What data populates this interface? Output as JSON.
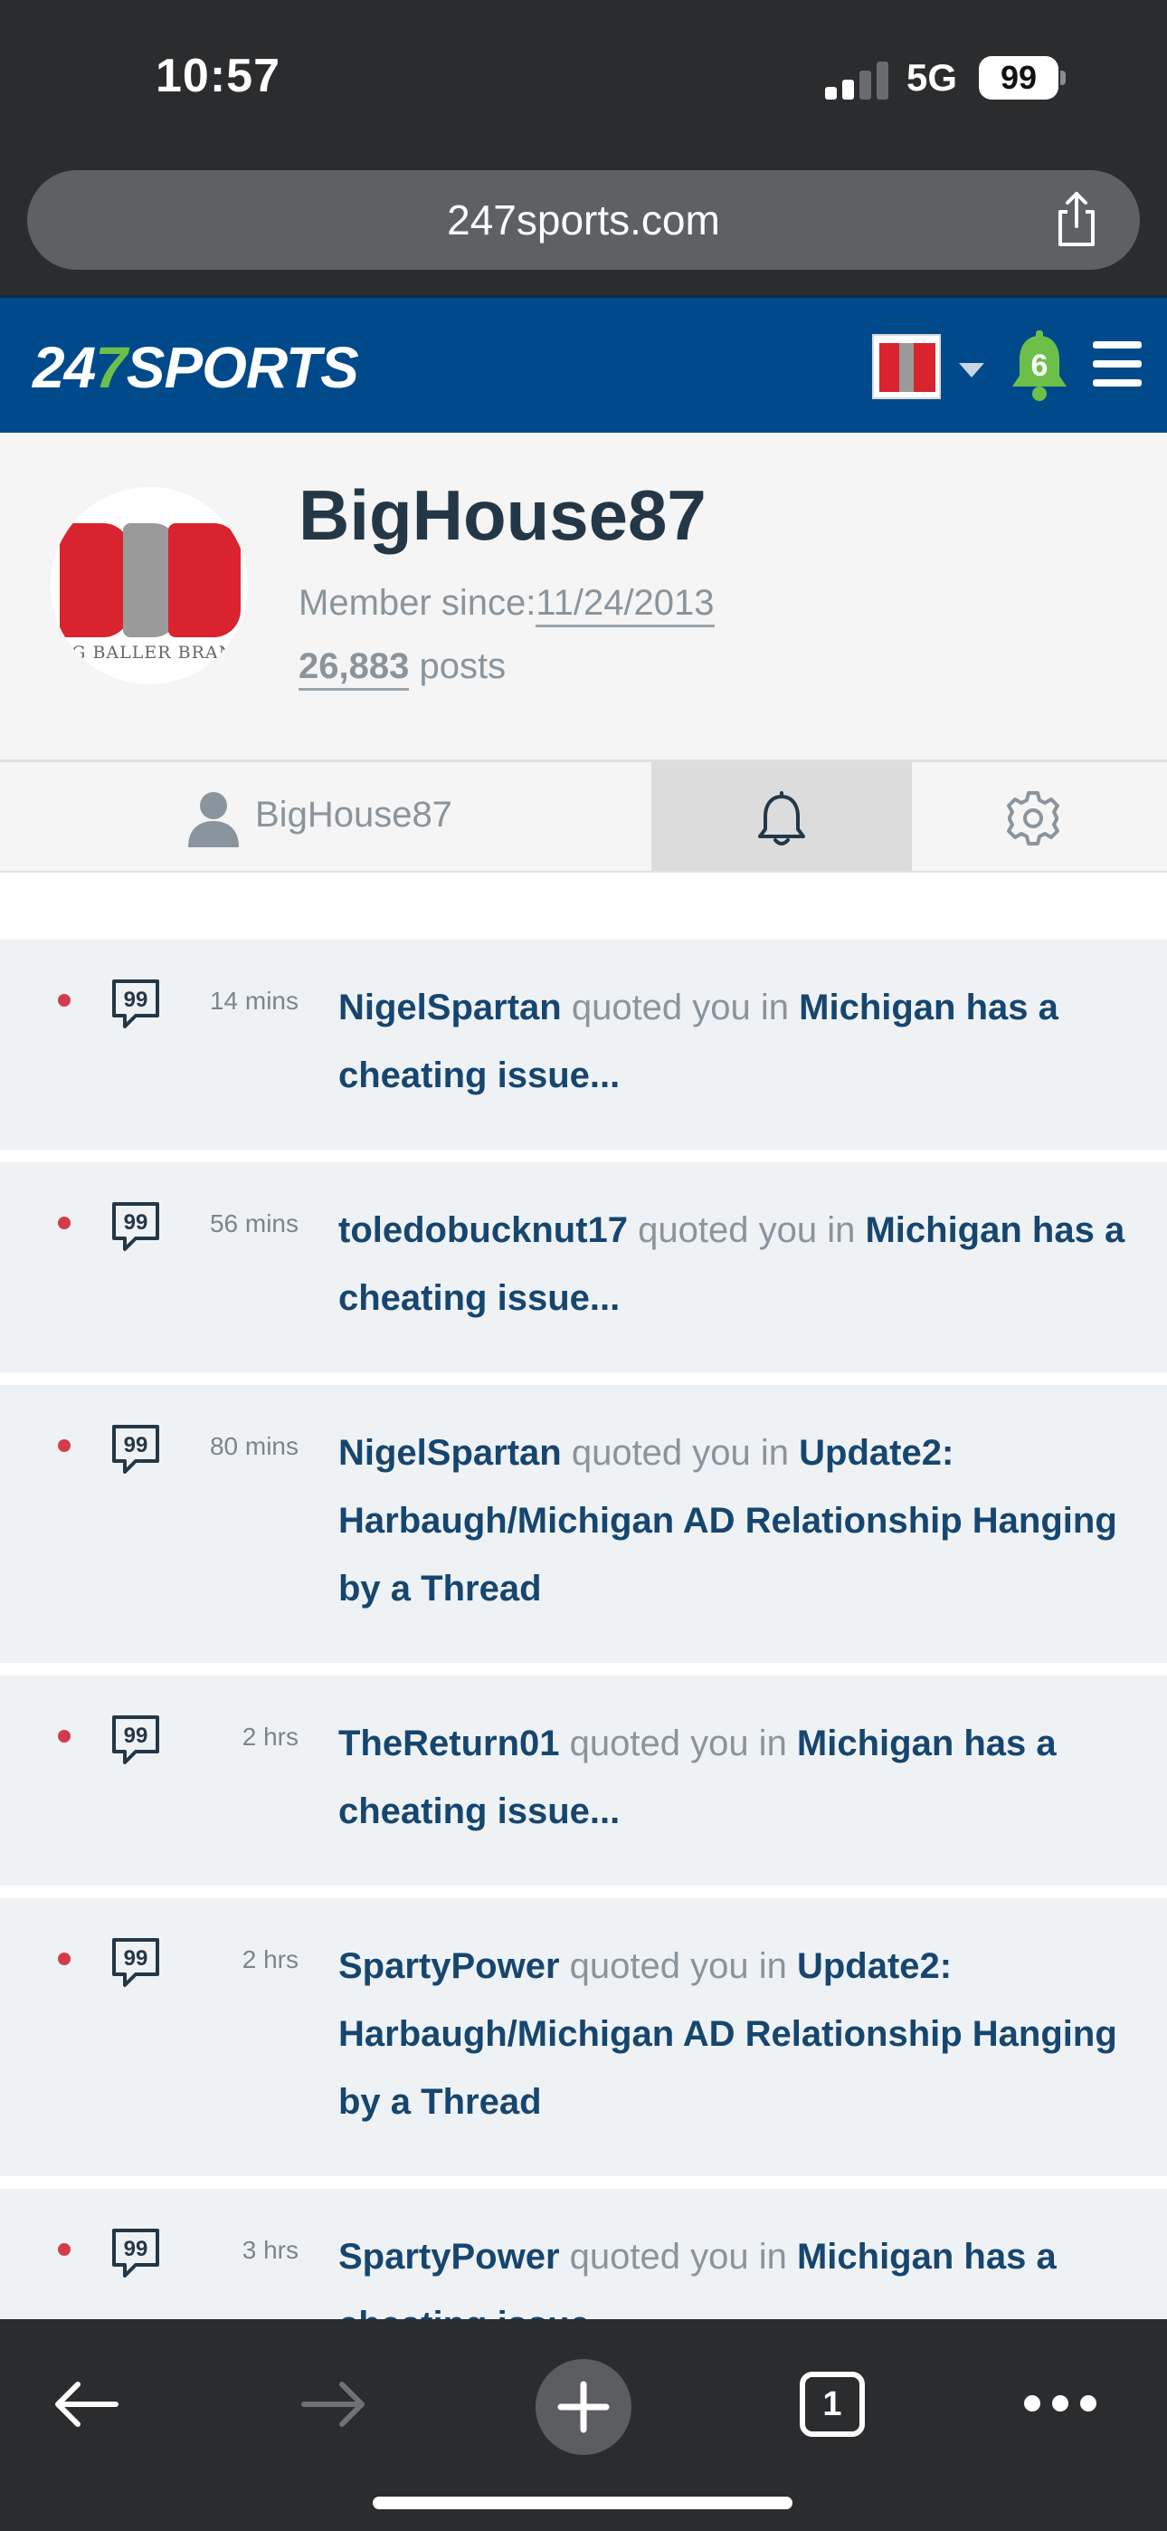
{
  "status_bar": {
    "time": "10:57",
    "network": "5G",
    "battery": "99"
  },
  "browser": {
    "url": "247sports.com",
    "tab_count": "1"
  },
  "site": {
    "logo_prefix": "24",
    "logo_seven": "7",
    "logo_suffix": "SPORTS",
    "notification_count": "6",
    "brand_colors": {
      "header": "#004a8b",
      "accent_green": "#6cc04a",
      "link": "#16466f",
      "unread_dot": "#d23c4b"
    }
  },
  "profile": {
    "name": "BigHouse87",
    "member_since_label": "Member since:",
    "member_since_date": "11/24/2013",
    "posts_count": "26,883",
    "posts_label": "posts",
    "avatar_letters": "BBB",
    "avatar_caption": "IG BALLER BRAN"
  },
  "tabs": {
    "profile_label": "BigHouse87",
    "notifications_icon": "bell-icon",
    "settings_icon": "gear-icon"
  },
  "notifications": [
    {
      "user": "NigelSpartan",
      "action": " quoted you in ",
      "thread": "Michigan has a cheating issue...",
      "time": "14 mins"
    },
    {
      "user": "toledobucknut17",
      "action": " quoted you in ",
      "thread": "Michigan has a cheating issue...",
      "time": "56 mins"
    },
    {
      "user": "NigelSpartan",
      "action": " quoted you in ",
      "thread": "Update2: Harbaugh/Michigan AD Relationship Hanging by a Thread",
      "time": "80 mins"
    },
    {
      "user": "TheReturn01",
      "action": " quoted you in ",
      "thread": "Michigan has a cheating issue...",
      "time": "2 hrs"
    },
    {
      "user": "SpartyPower",
      "action": " quoted you in ",
      "thread": "Update2: Harbaugh/Michigan AD Relationship Hanging by a Thread",
      "time": "2 hrs"
    },
    {
      "user": "SpartyPower",
      "action": " quoted you in ",
      "thread": "Michigan has a cheating issue...",
      "time": "3 hrs"
    }
  ]
}
